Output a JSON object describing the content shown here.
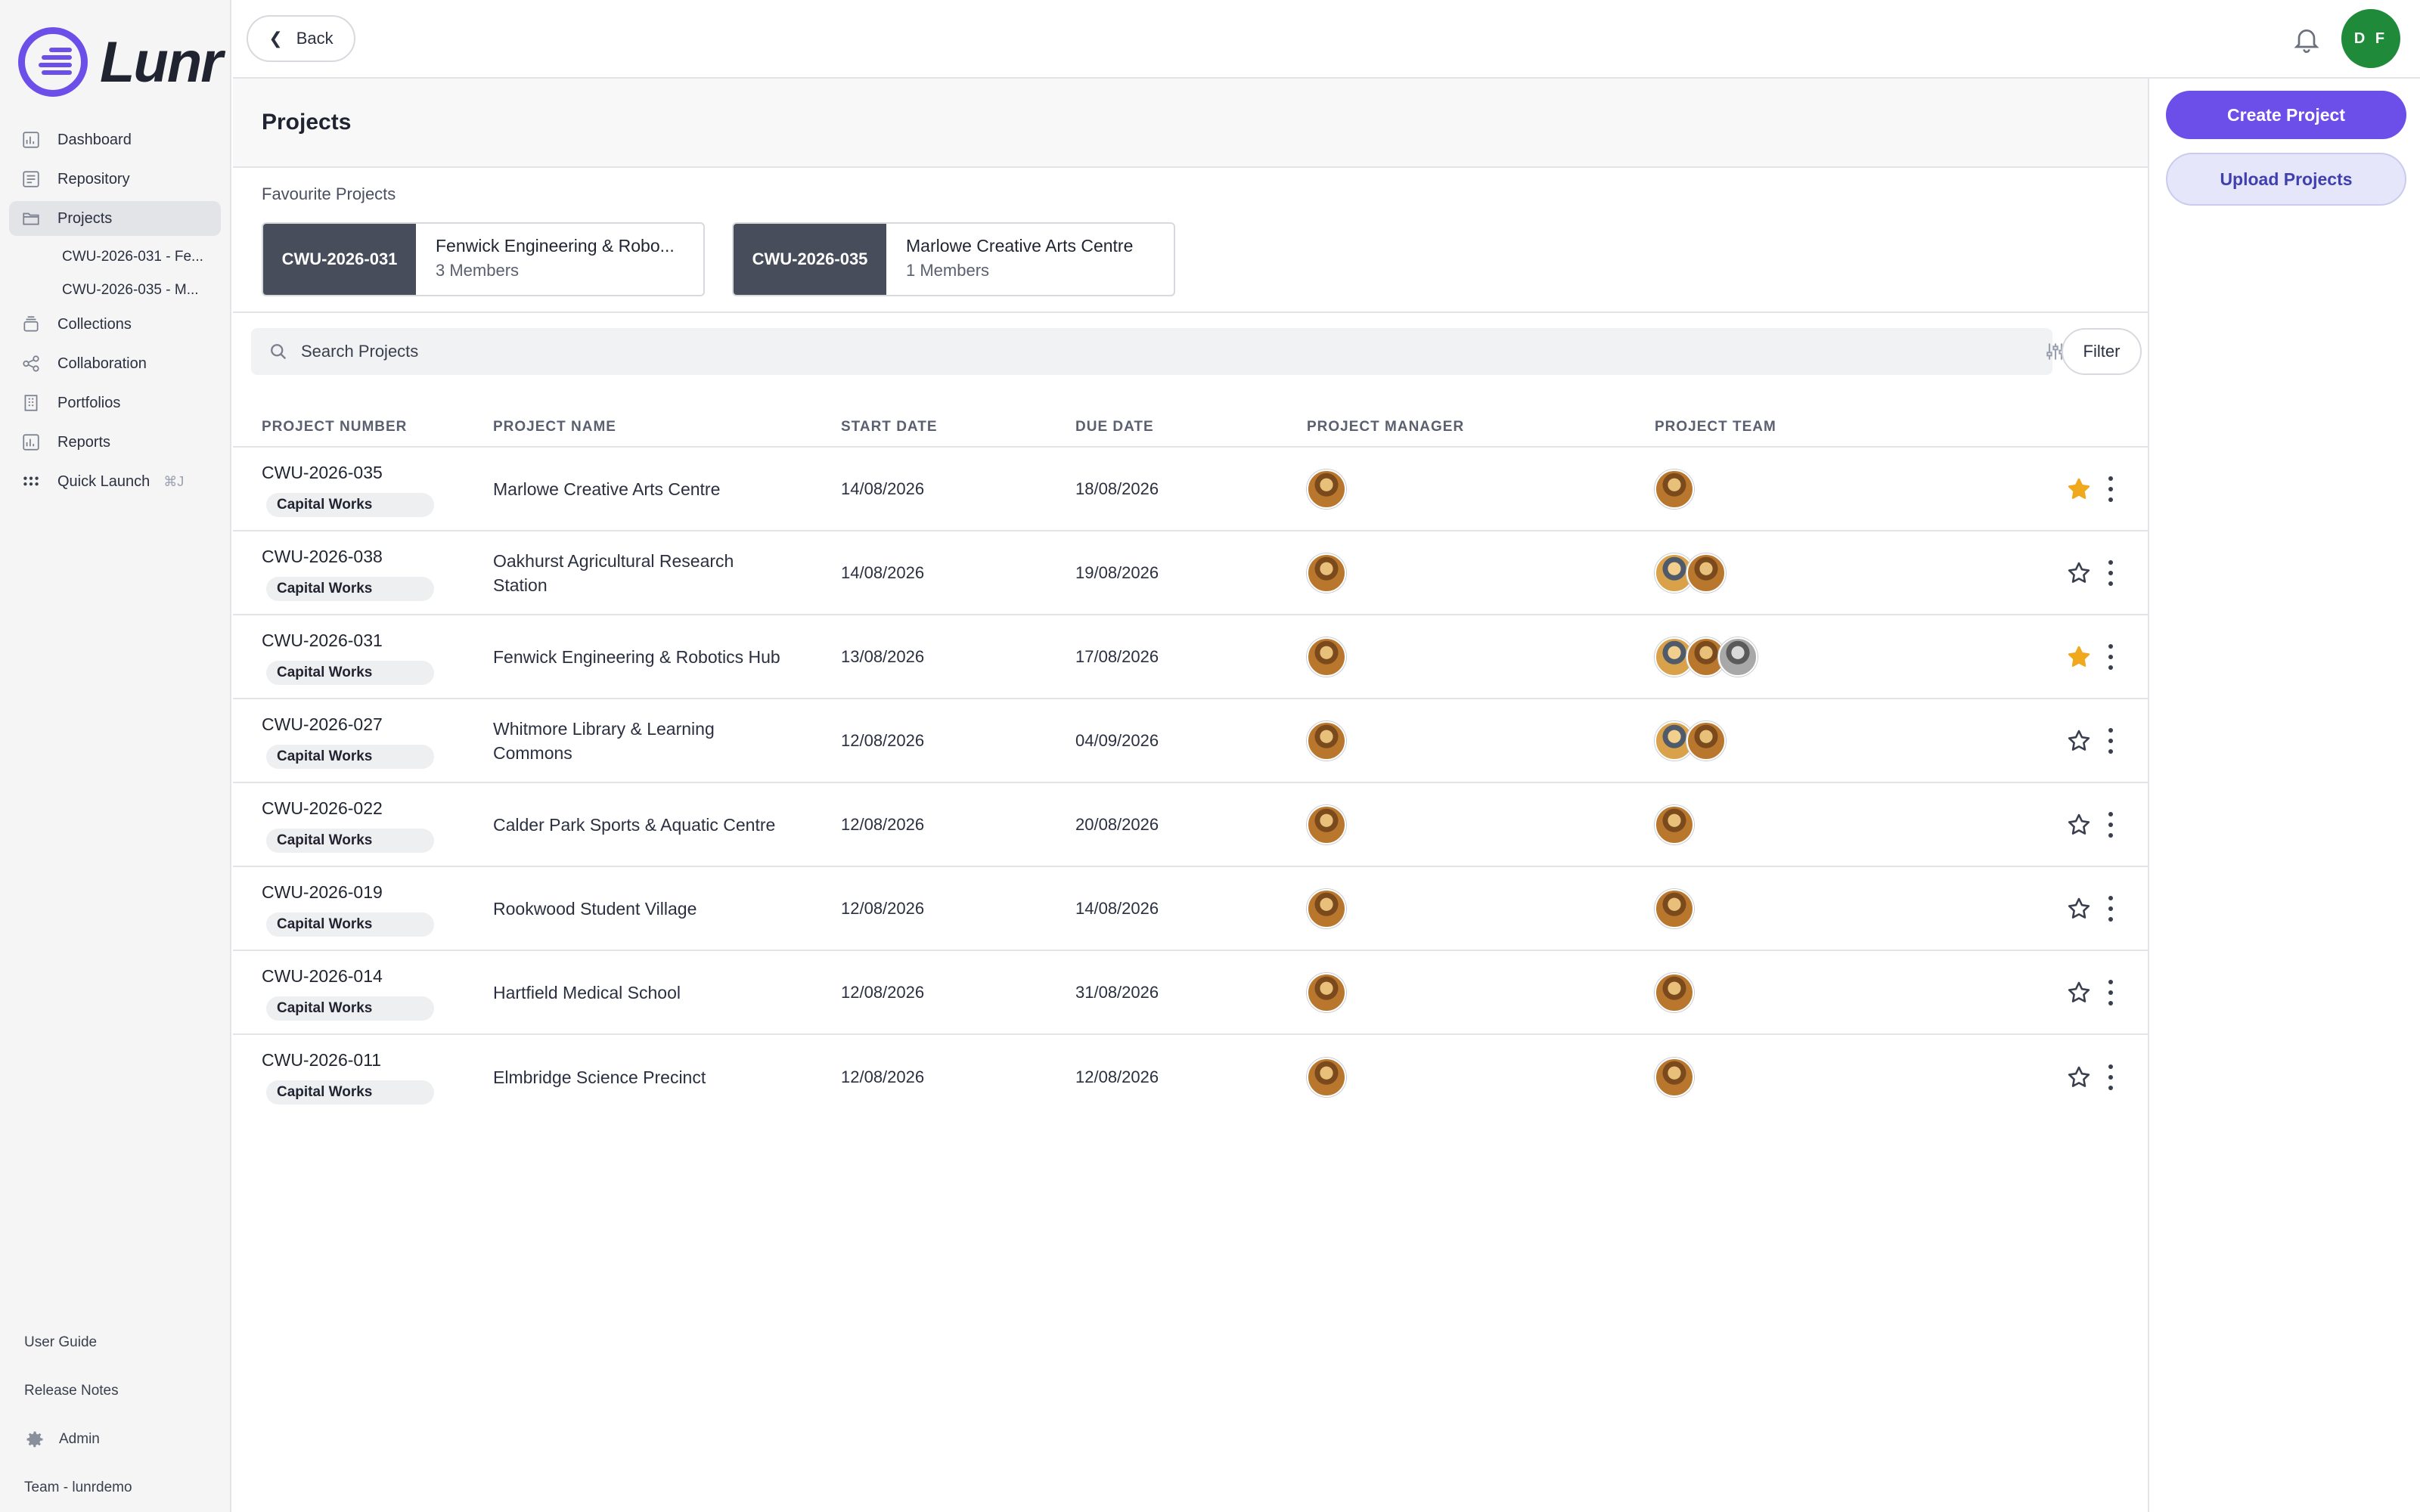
{
  "app": {
    "name": "Lunr"
  },
  "sidebar": {
    "items": [
      {
        "label": "Dashboard",
        "icon": "chart-icon"
      },
      {
        "label": "Repository",
        "icon": "repository-icon"
      },
      {
        "label": "Projects",
        "icon": "folder-icon",
        "active": true
      },
      {
        "label": "Collections",
        "icon": "collections-icon"
      },
      {
        "label": "Collaboration",
        "icon": "share-icon"
      },
      {
        "label": "Portfolios",
        "icon": "building-icon"
      },
      {
        "label": "Reports",
        "icon": "chart-icon"
      },
      {
        "label": "Quick Launch",
        "icon": "grid-dots-icon",
        "shortcut": "⌘J"
      }
    ],
    "project_subitems": [
      "CWU-2026-031 - Fe...",
      "CWU-2026-035 - M..."
    ],
    "bottom": {
      "user_guide": "User Guide",
      "release_notes": "Release Notes",
      "admin": "Admin",
      "team": "Team - lunrdemo"
    }
  },
  "topbar": {
    "back_label": "Back",
    "user_initials": "D F",
    "avatar_color": "#1f8a3a"
  },
  "page": {
    "title": "Projects"
  },
  "favourites": {
    "label": "Favourite Projects",
    "cards": [
      {
        "code": "CWU-2026-031",
        "name": "Fenwick Engineering & Robo...",
        "members": "3 Members"
      },
      {
        "code": "CWU-2026-035",
        "name": "Marlowe Creative Arts Centre",
        "members": "1 Members"
      }
    ]
  },
  "search": {
    "placeholder": "Search Projects",
    "filter_label": "Filter"
  },
  "table": {
    "headers": [
      "PROJECT NUMBER",
      "PROJECT NAME",
      "START DATE",
      "DUE DATE",
      "PROJECT MANAGER",
      "PROJECT TEAM"
    ],
    "rows": [
      {
        "number": "CWU-2026-035",
        "tag": "Capital Works",
        "name": "Marlowe Creative Arts Centre",
        "start": "14/08/2026",
        "due": "18/08/2026",
        "team_size": 1,
        "favourite": true
      },
      {
        "number": "CWU-2026-038",
        "tag": "Capital Works",
        "name": "Oakhurst Agricultural Research Station",
        "start": "14/08/2026",
        "due": "19/08/2026",
        "team_size": 2,
        "favourite": false
      },
      {
        "number": "CWU-2026-031",
        "tag": "Capital Works",
        "name": "Fenwick Engineering & Robotics Hub",
        "start": "13/08/2026",
        "due": "17/08/2026",
        "team_size": 3,
        "favourite": true
      },
      {
        "number": "CWU-2026-027",
        "tag": "Capital Works",
        "name": "Whitmore Library & Learning Commons",
        "start": "12/08/2026",
        "due": "04/09/2026",
        "team_size": 2,
        "favourite": false
      },
      {
        "number": "CWU-2026-022",
        "tag": "Capital Works",
        "name": "Calder Park Sports & Aquatic Centre",
        "start": "12/08/2026",
        "due": "20/08/2026",
        "team_size": 1,
        "favourite": false
      },
      {
        "number": "CWU-2026-019",
        "tag": "Capital Works",
        "name": "Rookwood Student Village",
        "start": "12/08/2026",
        "due": "14/08/2026",
        "team_size": 1,
        "favourite": false
      },
      {
        "number": "CWU-2026-014",
        "tag": "Capital Works",
        "name": "Hartfield Medical School",
        "start": "12/08/2026",
        "due": "31/08/2026",
        "team_size": 1,
        "favourite": false
      },
      {
        "number": "CWU-2026-011",
        "tag": "Capital Works",
        "name": "Elmbridge Science Precinct",
        "start": "12/08/2026",
        "due": "12/08/2026",
        "team_size": 1,
        "favourite": false
      }
    ]
  },
  "actions": {
    "create_label": "Create Project",
    "upload_label": "Upload Projects",
    "accent": "#6c4ee8"
  },
  "colors": {
    "star_active": "#f0a81c",
    "star_inactive": "#3a3f4d"
  }
}
